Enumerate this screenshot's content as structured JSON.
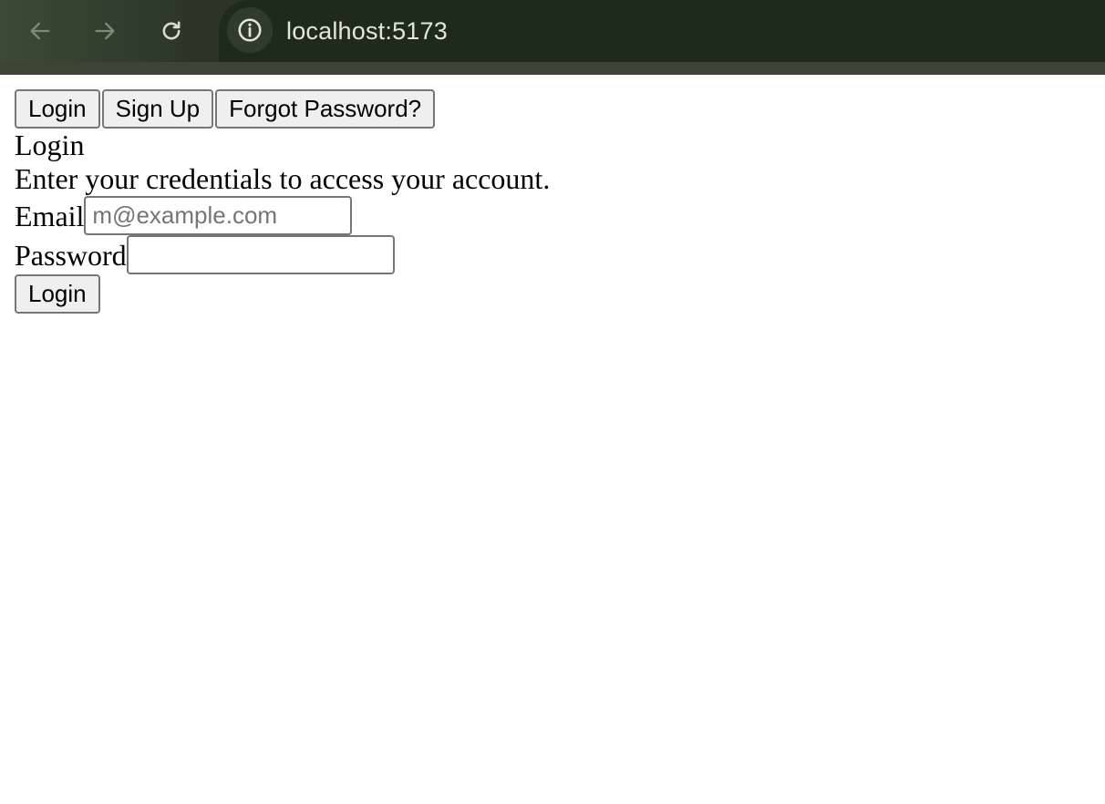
{
  "browser": {
    "url": "localhost:5173",
    "icons": {
      "back": "arrow-left-icon",
      "forward": "arrow-right-icon",
      "reload": "reload-icon",
      "site_info": "info-icon"
    },
    "colors": {
      "chrome_bg": "#23301f",
      "url_text": "#e3e6df"
    }
  },
  "auth_tabs": {
    "login": "Login",
    "sign_up": "Sign Up",
    "forgot": "Forgot Password?"
  },
  "form": {
    "title": "Login",
    "description": "Enter your credentials to access your account.",
    "email": {
      "label": "Email",
      "placeholder": "m@example.com",
      "value": ""
    },
    "password": {
      "label": "Password",
      "value": ""
    },
    "submit_label": "Login"
  }
}
